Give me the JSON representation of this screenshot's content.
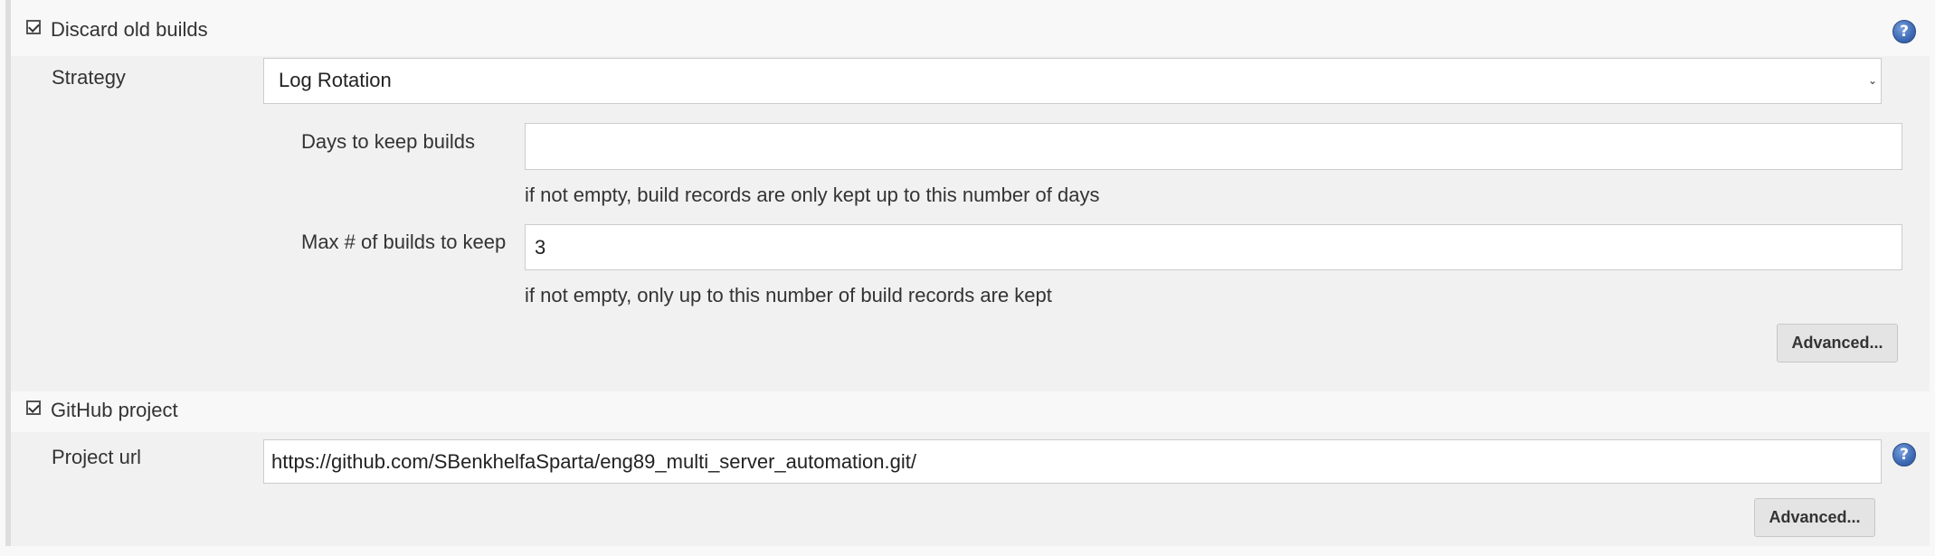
{
  "discard_old_builds": {
    "checked": true,
    "label": "Discard old builds",
    "help_glyph": "?",
    "strategy": {
      "label": "Strategy",
      "selected": "Log Rotation",
      "arrow_icon": "⌄"
    },
    "days_to_keep": {
      "label": "Days to keep builds",
      "value": "",
      "hint": "if not empty, build records are only kept up to this number of days"
    },
    "max_builds": {
      "label": "Max # of builds to keep",
      "value": "3",
      "hint": "if not empty, only up to this number of build records are kept"
    },
    "advanced_label": "Advanced..."
  },
  "github_project": {
    "checked": true,
    "label": "GitHub project",
    "project_url": {
      "label": "Project url",
      "value": "https://github.com/SBenkhelfaSparta/eng89_multi_server_automation.git/"
    },
    "help_glyph": "?",
    "advanced_label": "Advanced..."
  },
  "colors": {
    "help_icon": "#3d6ab4",
    "section_bg": "#f1f1f1",
    "page_bg": "#f8f8f8"
  }
}
